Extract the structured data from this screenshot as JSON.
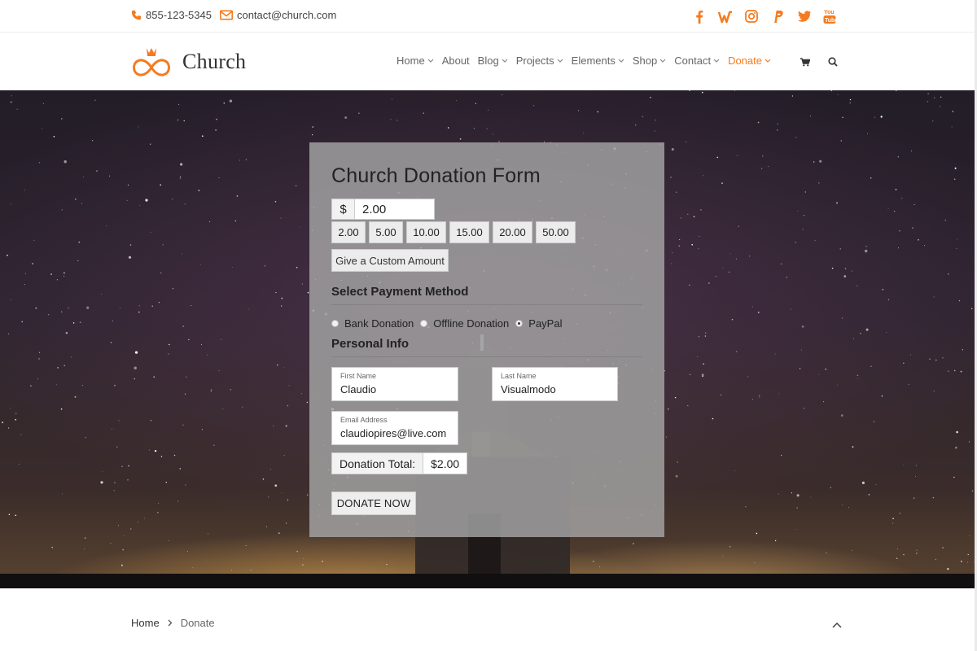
{
  "topbar": {
    "phone": "855-123-5345",
    "email": "contact@church.com",
    "social": [
      "facebook-icon",
      "wunderlist-icon",
      "instagram-icon",
      "paypal-icon",
      "twitter-icon",
      "youtube-icon"
    ]
  },
  "brand": {
    "name": "Church",
    "accent": "#f47b20"
  },
  "nav": {
    "items": [
      {
        "label": "Home",
        "dropdown": true
      },
      {
        "label": "About",
        "dropdown": false
      },
      {
        "label": "Blog",
        "dropdown": true
      },
      {
        "label": "Projects",
        "dropdown": true
      },
      {
        "label": "Elements",
        "dropdown": true
      },
      {
        "label": "Shop",
        "dropdown": true
      },
      {
        "label": "Contact",
        "dropdown": true
      },
      {
        "label": "Donate",
        "dropdown": true,
        "active": true
      }
    ]
  },
  "form": {
    "title": "Church Donation Form",
    "currency": "$",
    "amount": "2.00",
    "presets": [
      "2.00",
      "5.00",
      "10.00",
      "15.00",
      "20.00",
      "50.00"
    ],
    "custom_label": "Give a Custom Amount",
    "payment_heading": "Select Payment Method",
    "payment_methods": [
      {
        "label": "Bank Donation",
        "selected": false
      },
      {
        "label": "Offline Donation",
        "selected": false
      },
      {
        "label": "PayPal",
        "selected": true
      }
    ],
    "personal_heading": "Personal Info",
    "first_name_label": "First Name",
    "first_name": "Claudio",
    "last_name_label": "Last Name",
    "last_name": "Visualmodo",
    "email_label": "Email Address",
    "email": "claudiopires@live.com",
    "total_label": "Donation Total:",
    "total_value": "$2.00",
    "submit_label": "DONATE NOW"
  },
  "breadcrumb": {
    "home": "Home",
    "current": "Donate"
  }
}
